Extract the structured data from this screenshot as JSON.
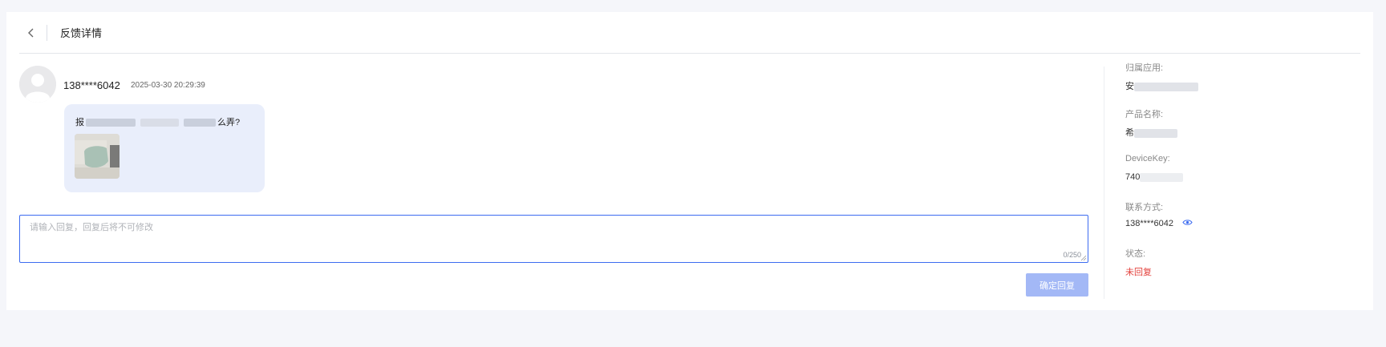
{
  "header": {
    "title": "反馈详情"
  },
  "feedback": {
    "username": "138****6042",
    "timestamp": "2025-03-30 20:29:39",
    "message_start": "报",
    "message_end": "么弄?"
  },
  "reply": {
    "placeholder": "请输入回复，回复后将不可修改",
    "char_count": "0/250",
    "submit_label": "确定回复"
  },
  "info": {
    "app_label": "归属应用:",
    "app_value_prefix": "安",
    "product_label": "产品名称:",
    "product_value_prefix": "希",
    "device_label": "DeviceKey:",
    "device_value_prefix": "740",
    "contact_label": "联系方式:",
    "contact_value": "138****6042",
    "status_label": "状态:",
    "status_value": "未回复"
  },
  "colors": {
    "accent": "#3d6cf0",
    "button_disabled": "#a3b8f6",
    "bubble": "#e9eefb",
    "status_pending": "#e3413c"
  },
  "icons": {
    "back": "chevron-left-icon",
    "avatar": "user-avatar-icon",
    "eye": "eye-icon"
  }
}
